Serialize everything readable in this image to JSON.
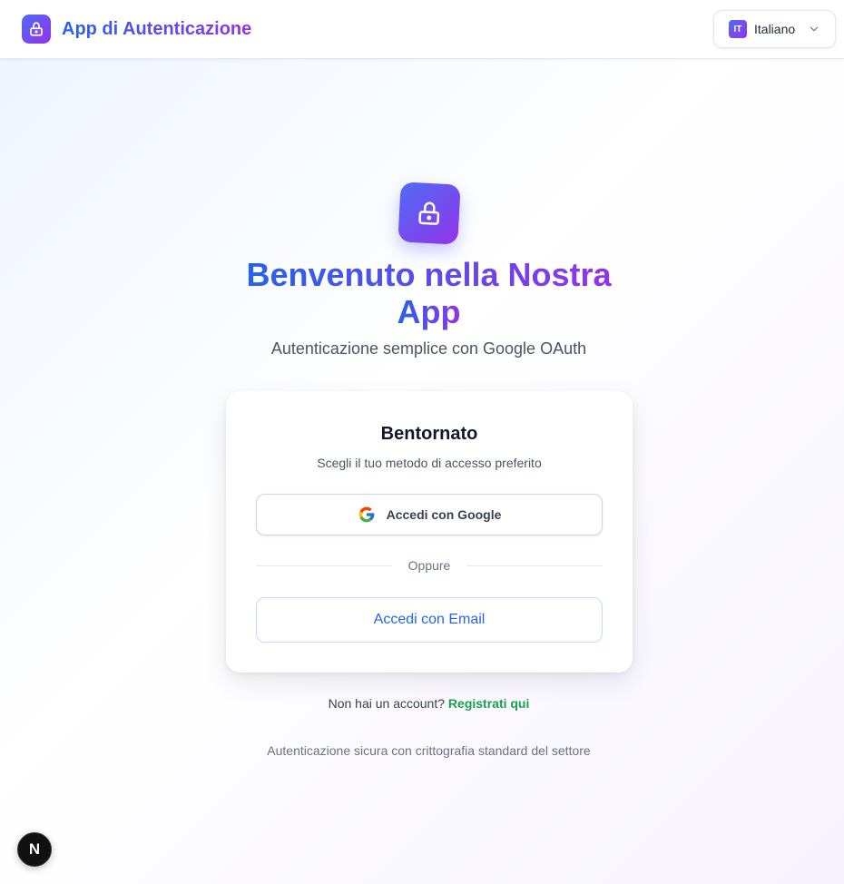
{
  "header": {
    "brand_icon": "lock-icon",
    "title": "App di Autenticazione",
    "language": {
      "badge": "IT",
      "label": "Italiano",
      "chevron_icon": "chevron-down-icon"
    }
  },
  "hero": {
    "icon": "lock-icon",
    "headline_line1": "Benvenuto nella Nostra",
    "headline_line2": "App",
    "subtitle": "Autenticazione semplice con Google OAuth"
  },
  "card": {
    "title": "Bentornato",
    "subtitle": "Scegli il tuo metodo di accesso preferito",
    "google_button": "Accedi con Google",
    "google_icon": "google-icon",
    "divider": "Oppure",
    "email_button": "Accedi con Email"
  },
  "signup": {
    "prompt": "Non hai un account?",
    "link": "Registrati qui"
  },
  "footer": {
    "note": "Autenticazione sicura con crittografia standard del settore"
  },
  "dev_badge": {
    "label": "N"
  },
  "colors": {
    "accent_blue": "#2563eb",
    "accent_purple": "#9333ea",
    "signup_link": "#16a34a"
  }
}
